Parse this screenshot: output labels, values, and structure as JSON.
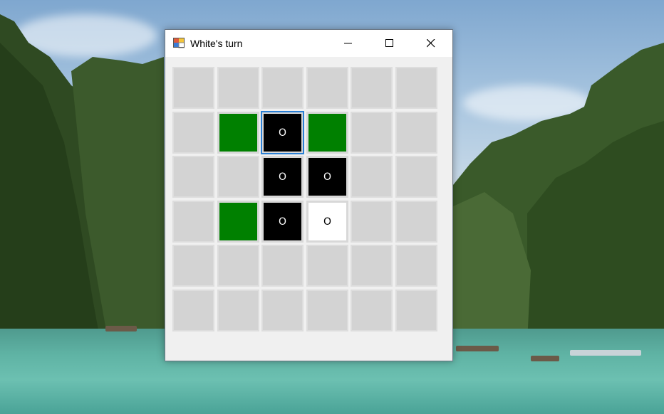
{
  "window": {
    "title": "White's turn"
  },
  "board": {
    "rows": [
      [
        "empty",
        "empty",
        "empty",
        "empty",
        "empty",
        "empty"
      ],
      [
        "empty",
        "move",
        "black",
        "move",
        "empty",
        "empty"
      ],
      [
        "empty",
        "empty",
        "black",
        "black",
        "empty",
        "empty"
      ],
      [
        "empty",
        "move",
        "black",
        "white",
        "empty",
        "empty"
      ],
      [
        "empty",
        "empty",
        "empty",
        "empty",
        "empty",
        "empty"
      ],
      [
        "empty",
        "empty",
        "empty",
        "empty",
        "empty",
        "empty"
      ]
    ],
    "piece_label": "O",
    "focused_cell": "1,2"
  },
  "colors": {
    "move_hint": "#008000",
    "black_piece": "#000000",
    "white_piece": "#ffffff",
    "empty": "#d3d3d3",
    "focus_ring": "#2a7fd4"
  }
}
